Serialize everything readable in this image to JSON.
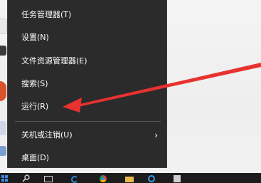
{
  "context_menu": {
    "items": [
      {
        "label": "任务管理器(T)"
      },
      {
        "label": "设置(N)"
      },
      {
        "label": "文件资源管理器(E)"
      },
      {
        "label": "搜索(S)"
      },
      {
        "label": "运行(R)"
      },
      {
        "label": "关机或注销(U)",
        "has_submenu": true
      },
      {
        "label": "桌面(D)"
      }
    ],
    "submenu_arrow_glyph": "›"
  },
  "taskbar": {
    "icons": [
      "windows-start-icon",
      "search-icon",
      "task-view-icon",
      "edge-icon",
      "chrome-icon",
      "folder-icon",
      "ie-icon",
      "store-icon"
    ]
  },
  "colors": {
    "menu_background": "#2b2b2b",
    "menu_text": "#ffffff",
    "annotation_arrow": "#e8322f",
    "taskbar": "#1c1c1c"
  }
}
